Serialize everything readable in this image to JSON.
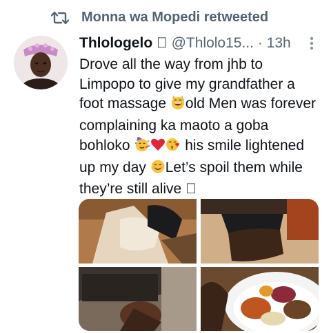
{
  "retweet": {
    "icon": "retweet-icon",
    "text": "Monna wa Mopedi retweeted"
  },
  "tweet": {
    "display_name": "Thlologelo",
    "name_glyph": "􀀀",
    "handle": "@Thlolo15...",
    "separator": "·",
    "time": "13h",
    "more_icon": "more-vertical-icon",
    "text_parts": {
      "p1": "Drove all the way from jhb to Limpopo to give my grandfather a foot massage ",
      "p2": "old  Men was forever complaining ka maoto a goba bohloko ",
      "p3": " his smile lightened up my day ",
      "p4": "Let’s spoil them while they’re still alive ",
      "end_glyph": "􀀀"
    },
    "emoji": {
      "e1": "grinning-cat-sweat-emoji",
      "e2": "partying-face-emoji",
      "e3": "red-heart-emoji",
      "e4": "face-blowing-kiss-emoji",
      "e5": "smiling-face-emoji"
    }
  },
  "media": {
    "photos": [
      "photo-massage-1",
      "photo-legs-2",
      "photo-feet-fire-3",
      "photo-plate-food-4"
    ]
  },
  "colors": {
    "secondary_text": "#536471",
    "primary_text": "#0f1419"
  }
}
